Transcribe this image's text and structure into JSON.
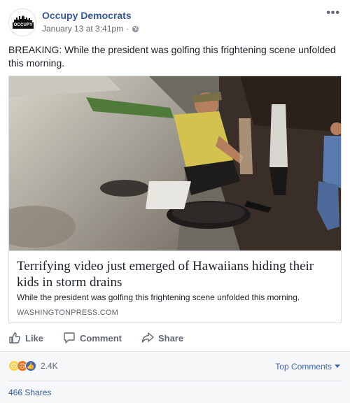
{
  "post": {
    "author": "Occupy Democrats",
    "timestamp": "January 13 at 3:41pm",
    "separator": "·",
    "privacy_icon": "globe-icon",
    "more_icon": "ellipsis-icon",
    "avatar_text": "OCCUPY",
    "text": "BREAKING: While the president was golfing this frightening scene unfolded this morning."
  },
  "link_card": {
    "title": "Terrifying video just emerged of Hawaiians hiding their kids in storm drains",
    "description": "While the president was golfing this frightening scene unfolded this morning.",
    "domain": "WASHINGTONPRESS.COM"
  },
  "actions": {
    "like_label": "Like",
    "comment_label": "Comment",
    "share_label": "Share"
  },
  "footer": {
    "reaction_count": "2.4K",
    "reactions": [
      "sad-reaction-icon",
      "angry-reaction-icon",
      "like-reaction-icon"
    ],
    "top_comments_label": "Top Comments",
    "shares_label": "466 Shares"
  },
  "colors": {
    "link_blue": "#365899",
    "accent_blue": "#4267b2",
    "muted_text": "#606770",
    "footer_bg": "#f6f7f9"
  }
}
